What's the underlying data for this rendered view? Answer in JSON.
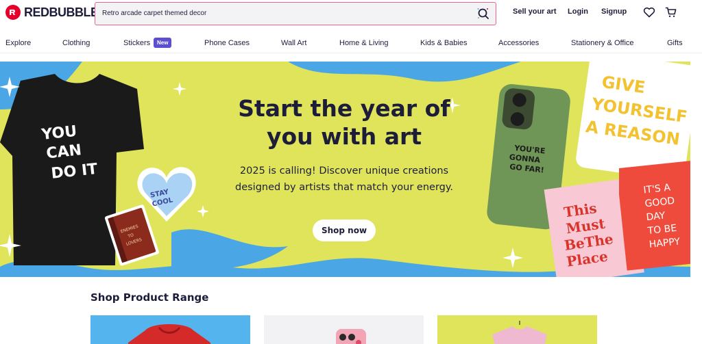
{
  "brand": {
    "name": "REDBUBBLE",
    "color": "#e4002b"
  },
  "search": {
    "value": "Retro arcade carpet themed decor"
  },
  "header_nav": {
    "sell": "Sell your art",
    "login": "Login",
    "signup": "Signup"
  },
  "categories": [
    {
      "label": "Explore"
    },
    {
      "label": "Clothing"
    },
    {
      "label": "Stickers",
      "badge": "New"
    },
    {
      "label": "Phone Cases"
    },
    {
      "label": "Wall Art"
    },
    {
      "label": "Home & Living"
    },
    {
      "label": "Kids & Babies"
    },
    {
      "label": "Accessories"
    },
    {
      "label": "Stationery & Office"
    },
    {
      "label": "Gifts"
    }
  ],
  "hero": {
    "title": "Start the year of you with art",
    "subtitle": "2025 is calling! Discover unique creations designed by artists that match your energy.",
    "cta": "Shop now",
    "colors": {
      "blue": "#4aa6e4",
      "yellow": "#dfe45a"
    },
    "art_text": {
      "tshirt": "YOU CAN DO IT",
      "sticker": "STAY COOL",
      "book": "ENEMIES TO LOVERS",
      "phone": "YOU'RE GONNA GO FAR!",
      "pillow": "GIVE YOURSELF A REASON",
      "print_pink": "This Must Be The Place",
      "print_red": "IT'S A GOOD DAY TO BE HAPPY"
    }
  },
  "product_range": {
    "title": "Shop Product Range"
  }
}
